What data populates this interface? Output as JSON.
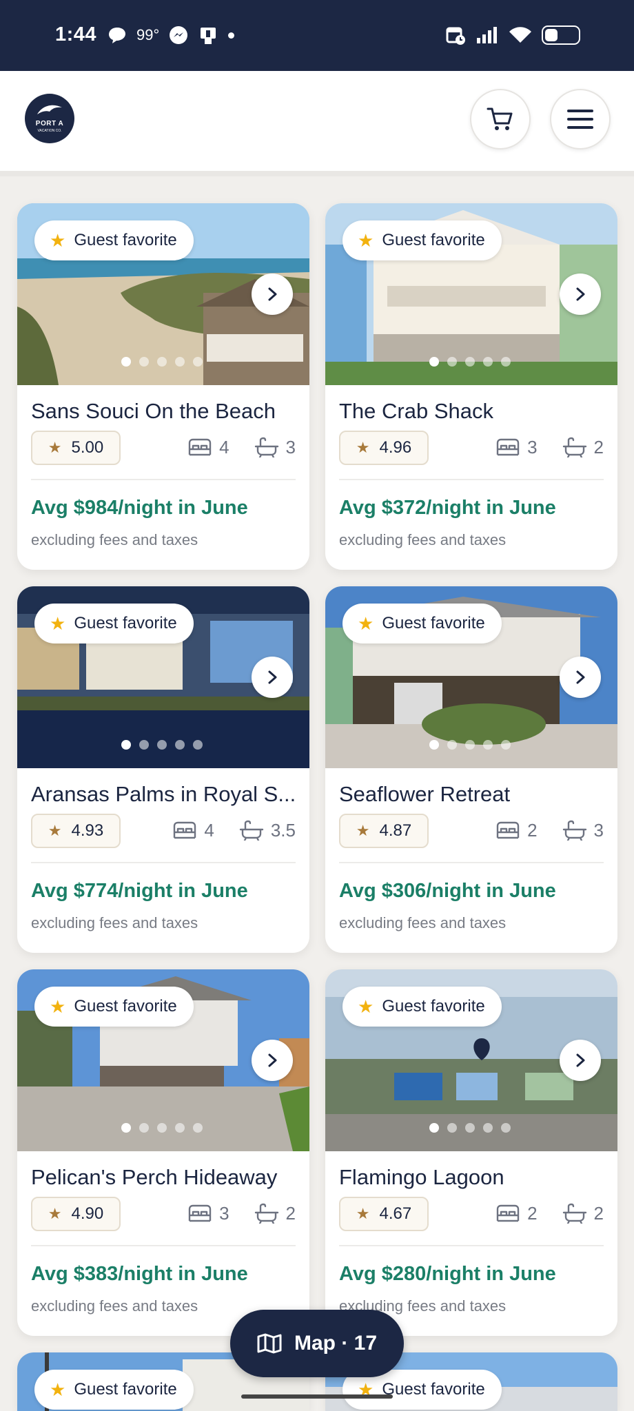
{
  "status_bar": {
    "time": "1:44",
    "temperature": "99°"
  },
  "header": {
    "logo_line1": "PORT A",
    "logo_line2": "VACATION CO."
  },
  "badge_label": "Guest favorite",
  "fees_note": "excluding fees and taxes",
  "listings": [
    {
      "name": "Sans Souci On the Beach",
      "rating": "5.00",
      "beds": "4",
      "baths": "3",
      "price": "Avg $984/night in June"
    },
    {
      "name": "The Crab Shack",
      "rating": "4.96",
      "beds": "3",
      "baths": "2",
      "price": "Avg $372/night in June"
    },
    {
      "name": "Aransas Palms in Royal S...",
      "rating": "4.93",
      "beds": "4",
      "baths": "3.5",
      "price": "Avg $774/night in June"
    },
    {
      "name": "Seaflower Retreat",
      "rating": "4.87",
      "beds": "2",
      "baths": "3",
      "price": "Avg $306/night in June"
    },
    {
      "name": "Pelican's Perch Hideaway",
      "rating": "4.90",
      "beds": "3",
      "baths": "2",
      "price": "Avg $383/night in June"
    },
    {
      "name": "Flamingo Lagoon",
      "rating": "4.67",
      "beds": "2",
      "baths": "2",
      "price": "Avg $280/night in June"
    }
  ],
  "map_button": {
    "label": "Map · 17"
  },
  "colors": {
    "navy": "#1c2744",
    "price_green": "#1b7f67",
    "star_gold": "#f2b20f"
  }
}
